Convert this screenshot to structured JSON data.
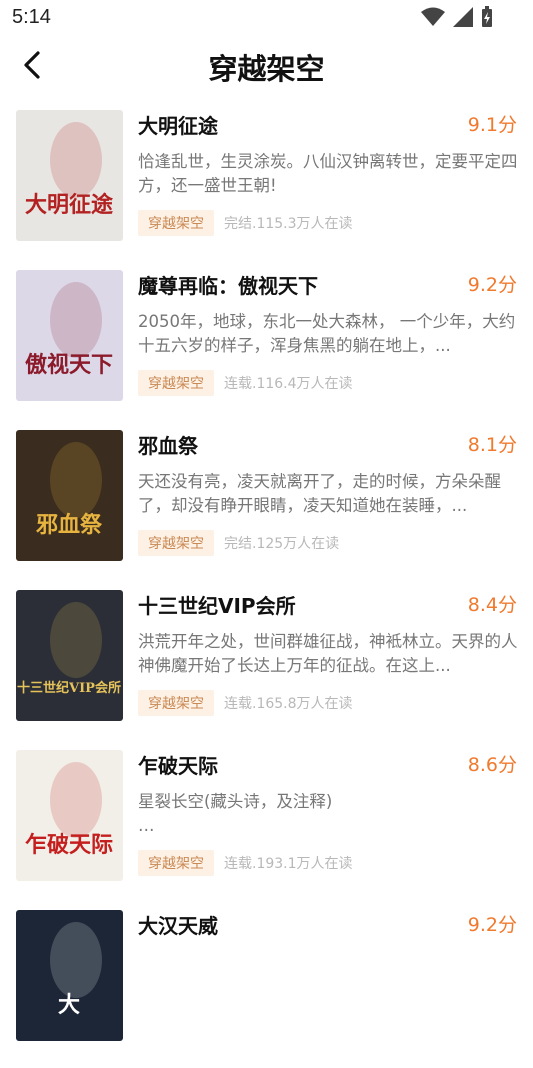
{
  "status_bar": {
    "time": "5:14"
  },
  "header": {
    "title": "穿越架空"
  },
  "books": [
    {
      "title": "大明征途",
      "score": "9.1分",
      "description": "恰逢乱世，生灵涂炭。八仙汉钟离转世，定要平定四方，还一盛世王朝!",
      "tag": "穿越架空",
      "status": "完结.115.3万人在读",
      "cover_text": "大明征途",
      "cover_colors": [
        "#e8e6e2",
        "#b22222"
      ]
    },
    {
      "title": "魔尊再临：傲视天下",
      "score": "9.2分",
      "description": "2050年，地球，东北一处大森林， 一个少年，大约十五六岁的样子，浑身焦黑的躺在地上，...",
      "tag": "穿越架空",
      "status": "连载.116.4万人在读",
      "cover_text": "傲视天下",
      "cover_colors": [
        "#dcd8e8",
        "#8b1a2b"
      ]
    },
    {
      "title": "邪血祭",
      "score": "8.1分",
      "description": "天还没有亮，凌天就离开了，走的时候，方朵朵醒了，却没有睁开眼睛，凌天知道她在装睡，...",
      "tag": "穿越架空",
      "status": "完结.125万人在读",
      "cover_text": "邪血祭",
      "cover_colors": [
        "#3a2c1e",
        "#e8b440"
      ]
    },
    {
      "title": "十三世纪VIP会所",
      "score": "8.4分",
      "description": "洪荒开年之处，世间群雄征战，神袛林立。天界的人神佛魔开始了长达上万年的征战。在这上...",
      "tag": "穿越架空",
      "status": "连载.165.8万人在读",
      "cover_text": "十三世纪VIP会所",
      "cover_colors": [
        "#2b2e36",
        "#e6c25a"
      ]
    },
    {
      "title": "乍破天际",
      "score": "8.6分",
      "description": "星裂长空(藏头诗，及注释)\n…",
      "tag": "穿越架空",
      "status": "连载.193.1万人在读",
      "cover_text": "乍破天际",
      "cover_colors": [
        "#f2efe8",
        "#c41e1e"
      ]
    },
    {
      "title": "大汉天威",
      "score": "9.2分",
      "description": "",
      "tag": "",
      "status": "",
      "cover_text": "大",
      "cover_colors": [
        "#1c2636",
        "#ffffff"
      ]
    }
  ]
}
